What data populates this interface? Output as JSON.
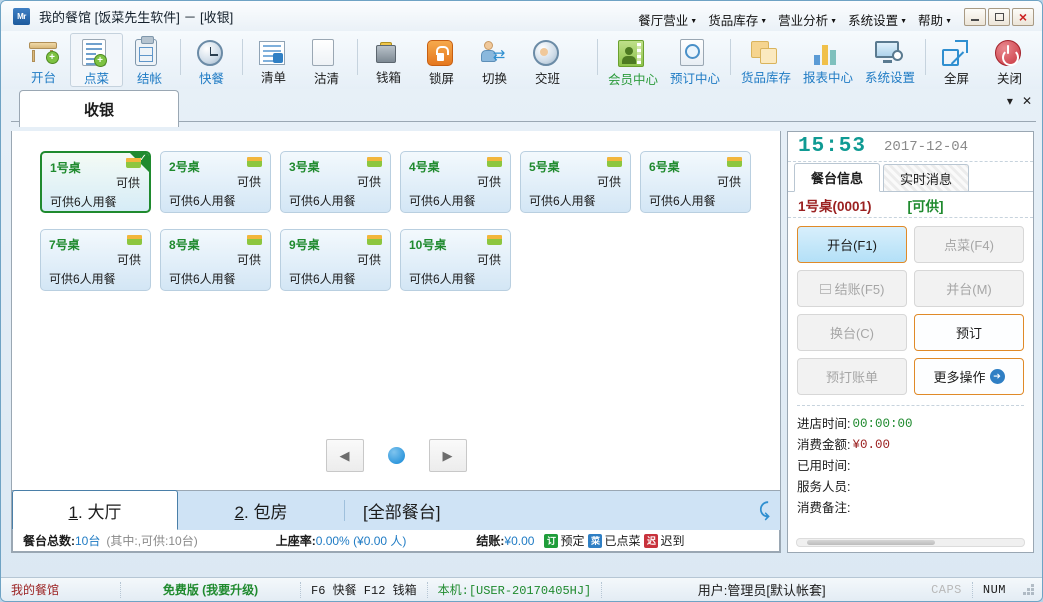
{
  "window": {
    "logo_text": "Mr",
    "title": "我的餐馆 [饭菜先生软件] － [收银]",
    "minimize": "minimize-button",
    "maximize": "maximize-button",
    "close": "×"
  },
  "menubar": [
    {
      "label": "餐厅营业"
    },
    {
      "label": "货品库存"
    },
    {
      "label": "营业分析"
    },
    {
      "label": "系统设置"
    },
    {
      "label": "帮助"
    }
  ],
  "toolbar_left": [
    {
      "label": "开台",
      "icon": "open-table-icon",
      "color": "blue",
      "active": false
    },
    {
      "label": "点菜",
      "icon": "order-dish-icon",
      "color": "blue",
      "active": true
    },
    {
      "label": "结帐",
      "icon": "checkout-icon",
      "color": "blue",
      "active": false
    },
    {
      "label": "快餐",
      "icon": "fastfood-clock-icon",
      "color": "blue",
      "active": false
    },
    {
      "label": "清单",
      "icon": "list-icon",
      "color": "black",
      "active": false
    },
    {
      "label": "沽清",
      "icon": "soldout-icon",
      "color": "black",
      "active": false
    },
    {
      "label": "钱箱",
      "icon": "cash-drawer-icon",
      "color": "black",
      "active": false
    },
    {
      "label": "锁屏",
      "icon": "lock-screen-icon",
      "color": "black",
      "active": false
    },
    {
      "label": "切换",
      "icon": "switch-user-icon",
      "color": "black",
      "active": false
    },
    {
      "label": "交班",
      "icon": "shift-change-icon",
      "color": "black",
      "active": false
    }
  ],
  "toolbar_right": [
    {
      "label": "会员中心",
      "icon": "member-center-icon",
      "color": "green"
    },
    {
      "label": "预订中心",
      "icon": "reservation-center-icon",
      "color": "blue"
    },
    {
      "label": "货品库存",
      "icon": "inventory-icon",
      "color": "blue"
    },
    {
      "label": "报表中心",
      "icon": "report-center-icon",
      "color": "blue"
    },
    {
      "label": "系统设置",
      "icon": "system-settings-icon",
      "color": "blue"
    },
    {
      "label": "全屏",
      "icon": "fullscreen-icon",
      "color": "black"
    },
    {
      "label": "关闭",
      "icon": "power-off-icon",
      "color": "black"
    }
  ],
  "content_tab": {
    "label": "收银"
  },
  "tables": [
    {
      "name": "1号桌",
      "status": "可供",
      "desc": "可供6人用餐",
      "selected": true
    },
    {
      "name": "2号桌",
      "status": "可供",
      "desc": "可供6人用餐",
      "selected": false
    },
    {
      "name": "3号桌",
      "status": "可供",
      "desc": "可供6人用餐",
      "selected": false
    },
    {
      "name": "4号桌",
      "status": "可供",
      "desc": "可供6人用餐",
      "selected": false
    },
    {
      "name": "5号桌",
      "status": "可供",
      "desc": "可供6人用餐",
      "selected": false
    },
    {
      "name": "6号桌",
      "status": "可供",
      "desc": "可供6人用餐",
      "selected": false
    },
    {
      "name": "7号桌",
      "status": "可供",
      "desc": "可供6人用餐",
      "selected": false
    },
    {
      "name": "8号桌",
      "status": "可供",
      "desc": "可供6人用餐",
      "selected": false
    },
    {
      "name": "9号桌",
      "status": "可供",
      "desc": "可供6人用餐",
      "selected": false
    },
    {
      "name": "10号桌",
      "status": "可供",
      "desc": "可供6人用餐",
      "selected": false
    }
  ],
  "pager": {
    "prev": "◀",
    "next": "▶"
  },
  "area_tabs": [
    {
      "num": "1",
      "dot": ". ",
      "label": "大厅",
      "active": true
    },
    {
      "num": "2",
      "dot": ". ",
      "label": "包房",
      "active": false
    }
  ],
  "area_all": "[全部餐台]",
  "statbar": {
    "total_key": "餐台总数:",
    "total_value": "10台",
    "total_note": "(其中:,可供:10台)",
    "rate_key": "上座率:",
    "rate_value": "0.00% (¥0.00 人)",
    "settle_key": "结账:",
    "settle_value": "¥0.00",
    "legend": [
      {
        "mark": "订",
        "label": "预定",
        "color": "#1f9d3a"
      },
      {
        "mark": "菜",
        "label": "已点菜",
        "color": "#2f7fc4"
      },
      {
        "mark": "迟",
        "label": "迟到",
        "color": "#c8323c"
      }
    ]
  },
  "right_panel": {
    "time": "15:53",
    "date": "2017-12-04",
    "tabs": [
      {
        "label": "餐台信息",
        "active": true
      },
      {
        "label": "实时消息",
        "active": false
      }
    ],
    "table_name": "1号桌(0001)",
    "table_status": "[可供]",
    "actions": [
      {
        "label": "开台(F1)",
        "state": "primary",
        "icon": ""
      },
      {
        "label": "点菜(F4)",
        "state": "disabled",
        "icon": ""
      },
      {
        "label": "结账(F5)",
        "state": "disabled",
        "icon": "grid-icon"
      },
      {
        "label": "并台(M)",
        "state": "disabled",
        "icon": ""
      },
      {
        "label": "换台(C)",
        "state": "disabled",
        "icon": ""
      },
      {
        "label": "预订",
        "state": "enabled",
        "icon": ""
      },
      {
        "label": "预打账单",
        "state": "disabled",
        "icon": ""
      },
      {
        "label": "更多操作",
        "state": "enabled",
        "icon": "arrow-right-circle-icon"
      }
    ],
    "info": [
      {
        "key": "进店时间:",
        "value": "00:00:00",
        "style": "green"
      },
      {
        "key": "消费金额:",
        "value": "¥0.00",
        "style": "red"
      },
      {
        "key": "已用时间:",
        "value": "",
        "style": "plain"
      },
      {
        "key": "服务人员:",
        "value": "",
        "style": "plain"
      },
      {
        "key": "消费备注:",
        "value": "",
        "style": "plain"
      }
    ]
  },
  "statusbar": {
    "shop": "我的餐馆",
    "edition": "免费版 (我要升级)",
    "hotkeys": "F6 快餐 F12 钱箱",
    "machine": "本机:[USER-20170405HJ]",
    "user": "用户:管理员[默认帐套]",
    "caps": "CAPS",
    "num": "NUM"
  }
}
